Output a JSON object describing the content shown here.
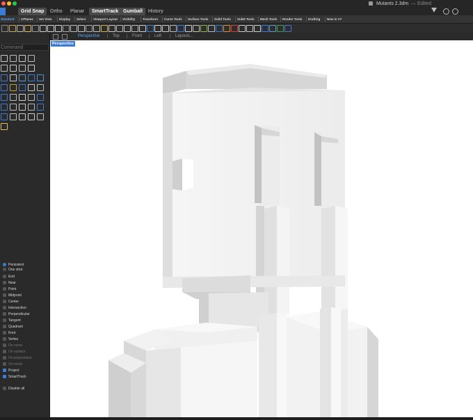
{
  "window": {
    "document_title": "Mutants 2.3dm",
    "edited_label": "— Edited",
    "traffic_colors": [
      "#ff5f57",
      "#febc2e",
      "#28c840"
    ]
  },
  "modes": [
    {
      "label": "Grid Snap",
      "active": true
    },
    {
      "label": "Ortho",
      "active": false
    },
    {
      "label": "Planar",
      "active": false
    },
    {
      "label": "SmartTrack",
      "active": true
    },
    {
      "label": "Gumball",
      "active": true
    },
    {
      "label": "History",
      "active": false
    }
  ],
  "toolbar_tabs": [
    {
      "label": "Standard",
      "active": true
    },
    {
      "label": "CPlanes"
    },
    {
      "label": "Set View"
    },
    {
      "label": "Display"
    },
    {
      "label": "Select"
    },
    {
      "label": "Viewport Layout"
    },
    {
      "label": "Visibility"
    },
    {
      "label": "Transform"
    },
    {
      "label": "Curve Tools"
    },
    {
      "label": "Surface Tools"
    },
    {
      "label": "Solid Tools"
    },
    {
      "label": "SubD Tools"
    },
    {
      "label": "Mesh Tools"
    },
    {
      "label": "Render Tools"
    },
    {
      "label": "Drafting"
    },
    {
      "label": "New in V7"
    }
  ],
  "command": {
    "placeholder": "Command"
  },
  "viewport_tabs": [
    {
      "label": "Perspective",
      "active": true
    },
    {
      "label": "Top"
    },
    {
      "label": "Front"
    },
    {
      "label": "Left"
    },
    {
      "label": "Layouts..."
    }
  ],
  "viewport": {
    "label": "Perspective"
  },
  "osnap": {
    "modes": [
      {
        "label": "Persistent",
        "checked": true
      },
      {
        "label": "One shot",
        "checked": false
      }
    ],
    "items": [
      {
        "label": "End",
        "checked": false,
        "enabled": true
      },
      {
        "label": "Near",
        "checked": false,
        "enabled": true
      },
      {
        "label": "Point",
        "checked": false,
        "enabled": true
      },
      {
        "label": "Midpoint",
        "checked": false,
        "enabled": true
      },
      {
        "label": "Center",
        "checked": false,
        "enabled": true
      },
      {
        "label": "Intersection",
        "checked": false,
        "enabled": true
      },
      {
        "label": "Perpendicular",
        "checked": false,
        "enabled": true
      },
      {
        "label": "Tangent",
        "checked": false,
        "enabled": true
      },
      {
        "label": "Quadrant",
        "checked": false,
        "enabled": true
      },
      {
        "label": "Knot",
        "checked": false,
        "enabled": true
      },
      {
        "label": "Vertex",
        "checked": false,
        "enabled": true
      },
      {
        "label": "On curve",
        "checked": false,
        "enabled": false
      },
      {
        "label": "On surface",
        "checked": false,
        "enabled": false
      },
      {
        "label": "On polysurface",
        "checked": false,
        "enabled": false
      },
      {
        "label": "On mesh",
        "checked": false,
        "enabled": false
      },
      {
        "label": "Project",
        "checked": true,
        "enabled": true
      },
      {
        "label": "SmartTrack",
        "checked": true,
        "enabled": true
      }
    ],
    "disable_all": "Disable all"
  }
}
